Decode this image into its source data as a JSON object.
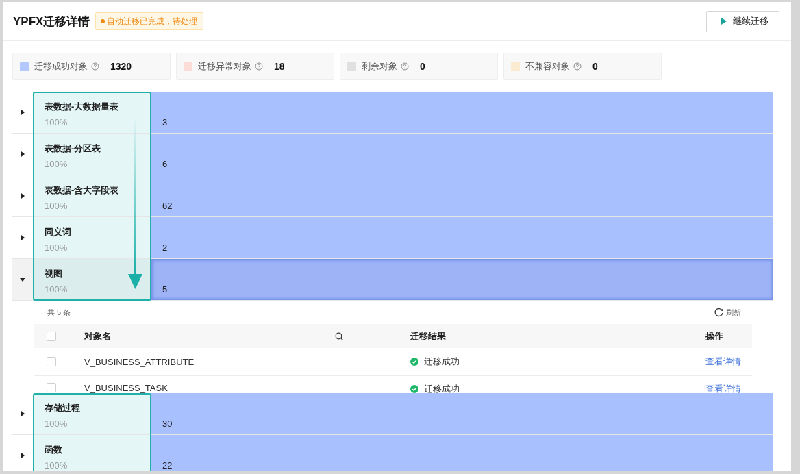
{
  "header": {
    "title": "YPFX迁移详情",
    "status_tag": "自动迁移已完成，待处理",
    "action_button": "继续迁移"
  },
  "stats": [
    {
      "label": "迁移成功对象",
      "value": "1320",
      "color": "#b3c8fd"
    },
    {
      "label": "迁移异常对象",
      "value": "18",
      "color": "#fcdcd6"
    },
    {
      "label": "剩余对象",
      "value": "0",
      "color": "#e0e0e0"
    },
    {
      "label": "不兼容对象",
      "value": "0",
      "color": "#fbebd0"
    }
  ],
  "categories": [
    {
      "name": "表数据-大数据量表",
      "progress": "100%",
      "count": "3",
      "expanded": false,
      "selected": false,
      "highlighted": true
    },
    {
      "name": "表数据-分区表",
      "progress": "100%",
      "count": "6",
      "expanded": false,
      "selected": false,
      "highlighted": true
    },
    {
      "name": "表数据-含大字段表",
      "progress": "100%",
      "count": "62",
      "expanded": false,
      "selected": false,
      "highlighted": true
    },
    {
      "name": "同义词",
      "progress": "100%",
      "count": "2",
      "expanded": false,
      "selected": false,
      "highlighted": true
    },
    {
      "name": "视图",
      "progress": "100%",
      "count": "5",
      "expanded": true,
      "selected": true,
      "highlighted": true,
      "detail": {
        "total": "共 5 条",
        "refresh": "刷新",
        "all_checked": false,
        "columns": [
          "对象名",
          "迁移结果",
          "操作"
        ],
        "rows": [
          {
            "name": "V_BUSINESS_ATTRIBUTE",
            "result": "迁移成功",
            "action": "查看详情",
            "checked": false
          },
          {
            "name": "V_BUSINESS_TASK",
            "result": "迁移成功",
            "action": "查看详情",
            "checked": false
          }
        ]
      }
    },
    {
      "name": "存储过程",
      "progress": "100%",
      "count": "30",
      "expanded": false,
      "selected": false,
      "highlighted": true
    },
    {
      "name": "函数",
      "progress": "100%",
      "count": "22",
      "expanded": false,
      "selected": false,
      "highlighted": true
    }
  ],
  "highlight_arrow": true
}
